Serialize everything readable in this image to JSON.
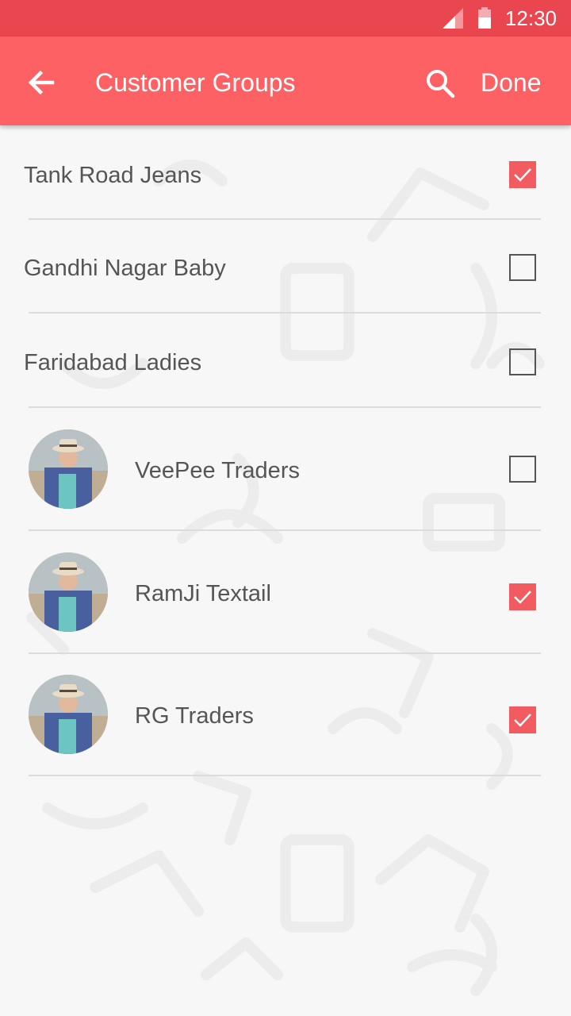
{
  "status_bar": {
    "time": "12:30",
    "icons": [
      "signal-icon",
      "battery-icon"
    ]
  },
  "app_bar": {
    "back_icon": "arrow-left-icon",
    "title": "Customer Groups",
    "search_icon": "search-icon",
    "done_label": "Done"
  },
  "colors": {
    "status_bar": "#e9464f",
    "app_bar": "#fd6164",
    "checkbox_checked": "#f25c61",
    "text": "#555555"
  },
  "groups": [
    {
      "name": "Tank Road Jeans",
      "has_avatar": false,
      "checked": true
    },
    {
      "name": "Gandhi Nagar Baby",
      "has_avatar": false,
      "checked": false
    },
    {
      "name": "Faridabad Ladies",
      "has_avatar": false,
      "checked": false
    },
    {
      "name": "VeePee Traders",
      "has_avatar": true,
      "checked": false
    },
    {
      "name": "RamJi Textail",
      "has_avatar": true,
      "checked": true
    },
    {
      "name": "RG Traders",
      "has_avatar": true,
      "checked": true
    }
  ]
}
